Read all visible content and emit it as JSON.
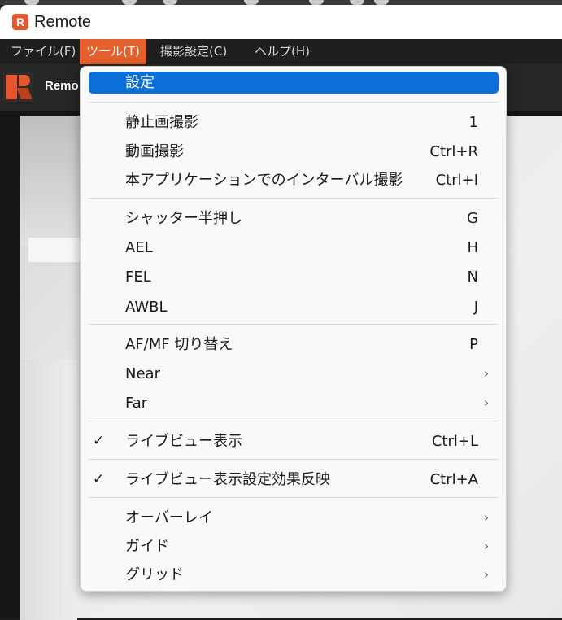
{
  "window": {
    "title": "Remote",
    "icon": "remote-app-icon",
    "icon_letter": "R"
  },
  "menubar": {
    "items": [
      {
        "label": "ファイル(F)"
      },
      {
        "label": "ツール(T)"
      },
      {
        "label": "撮影設定(C)"
      },
      {
        "label": "ヘルプ(H)"
      }
    ]
  },
  "toolbar": {
    "app_name": "Remo"
  },
  "dropdown": {
    "items": [
      {
        "label": "設定",
        "shortcut": ""
      },
      {
        "label": "静止画撮影",
        "shortcut": "1"
      },
      {
        "label": "動画撮影",
        "shortcut": "Ctrl+R"
      },
      {
        "label": "本アプリケーションでのインターバル撮影",
        "shortcut": "Ctrl+I"
      },
      {
        "label": "シャッター半押し",
        "shortcut": "G"
      },
      {
        "label": "AEL",
        "shortcut": "H"
      },
      {
        "label": "FEL",
        "shortcut": "N"
      },
      {
        "label": "AWBL",
        "shortcut": "J"
      },
      {
        "label": "AF/MF 切り替え",
        "shortcut": "P"
      },
      {
        "label": "Near",
        "shortcut": ""
      },
      {
        "label": "Far",
        "shortcut": ""
      },
      {
        "label": "ライブビュー表示",
        "shortcut": "Ctrl+L"
      },
      {
        "label": "ライブビュー表示設定効果反映",
        "shortcut": "Ctrl+A"
      },
      {
        "label": "オーバーレイ",
        "shortcut": ""
      },
      {
        "label": "ガイド",
        "shortcut": ""
      },
      {
        "label": "グリッド",
        "shortcut": ""
      }
    ],
    "check_glyph": "✓",
    "submenu_glyph": "›"
  },
  "colors": {
    "accent": "#e4602c",
    "highlight": "#0a6fd6",
    "menubar_bg": "#1f1f1f"
  }
}
